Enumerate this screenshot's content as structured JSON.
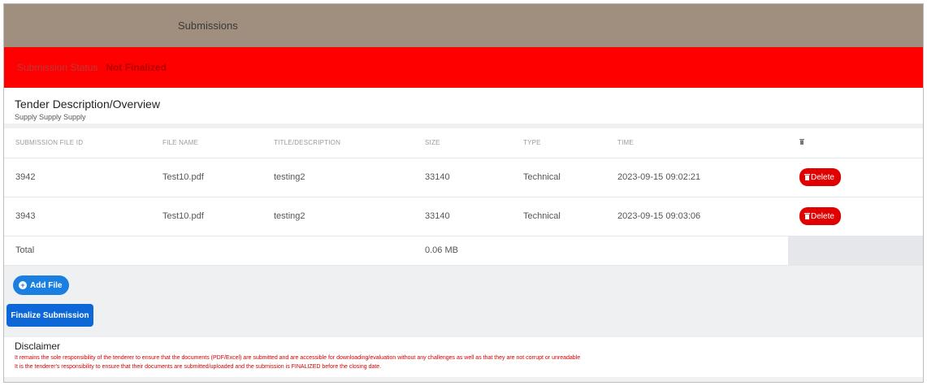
{
  "header": {
    "title": "Submissions"
  },
  "status": {
    "label": "Submission Status",
    "value": "Not Finalized"
  },
  "overview": {
    "title": "Tender Description/Overview",
    "description": "Supply Supply Supply"
  },
  "table": {
    "columns": [
      "SUBMISSION FILE ID",
      "FILE NAME",
      "TITLE/DESCRIPTION",
      "SIZE",
      "TYPE",
      "TIME"
    ],
    "action_column_icon": "trash-icon",
    "rows": [
      {
        "id": "3942",
        "file_name": "Test10.pdf",
        "title": "testing2",
        "size": "33140",
        "type": "Technical",
        "time": "2023-09-15 09:02:21",
        "action": "Delete"
      },
      {
        "id": "3943",
        "file_name": "Test10.pdf",
        "title": "testing2",
        "size": "33140",
        "type": "Technical",
        "time": "2023-09-15 09:03:06",
        "action": "Delete"
      }
    ],
    "total": {
      "label": "Total",
      "size": "0.06 MB"
    }
  },
  "actions": {
    "add_file": "Add File",
    "finalize": "Finalize Submission"
  },
  "disclaimer": {
    "title": "Disclaimer",
    "lines": [
      "It remains the sole responsibility of the tenderer to ensure that the documents (PDF/Excel) are submitted and are accessible for downloading/evaluation without any challenges as well as that they are not corrupt or unreadable",
      "It is the tenderer's responsibility to ensure that their documents are submitted/uploaded and the submission is FINALIZED before the closing date."
    ]
  },
  "colors": {
    "header_bg": "#a08e7e",
    "status_bg": "#ff0000",
    "delete": "#e00000",
    "primary": "#1a7fe0",
    "disclaimer_text": "#d40000"
  }
}
